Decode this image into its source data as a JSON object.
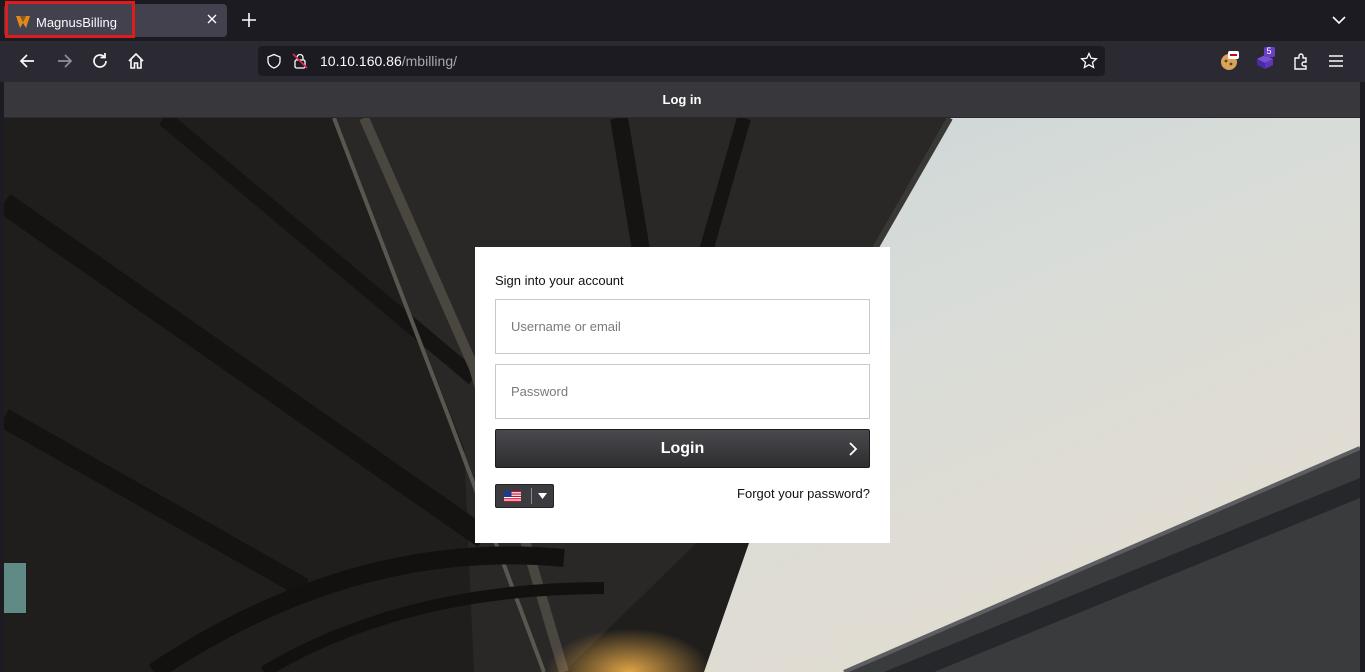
{
  "browser": {
    "tab": {
      "title": "MagnusBilling",
      "favicon": "magnusbilling-logo-icon"
    },
    "new_tab_icon": "plus-icon",
    "list_tabs_icon": "chevron-down-icon",
    "nav": {
      "back_icon": "back-arrow-icon",
      "forward_icon": "forward-arrow-icon",
      "reload_icon": "reload-icon",
      "home_icon": "home-icon"
    },
    "url": {
      "host": "10.10.160.86",
      "path": "/mbilling/"
    },
    "extensions": {
      "badge_count": "5"
    }
  },
  "page": {
    "header_title": "Log in",
    "login": {
      "heading": "Sign into your account",
      "username_placeholder": "Username or email",
      "username_value": "",
      "password_placeholder": "Password",
      "password_value": "",
      "button_label": "Login",
      "language_selected": "en-US",
      "forgot_link": "Forgot your password?"
    }
  },
  "colors": {
    "highlight": "#e01b1b",
    "toolbar": "#2b2a33",
    "tabstrip": "#1c1b22",
    "header": "#38383c"
  }
}
